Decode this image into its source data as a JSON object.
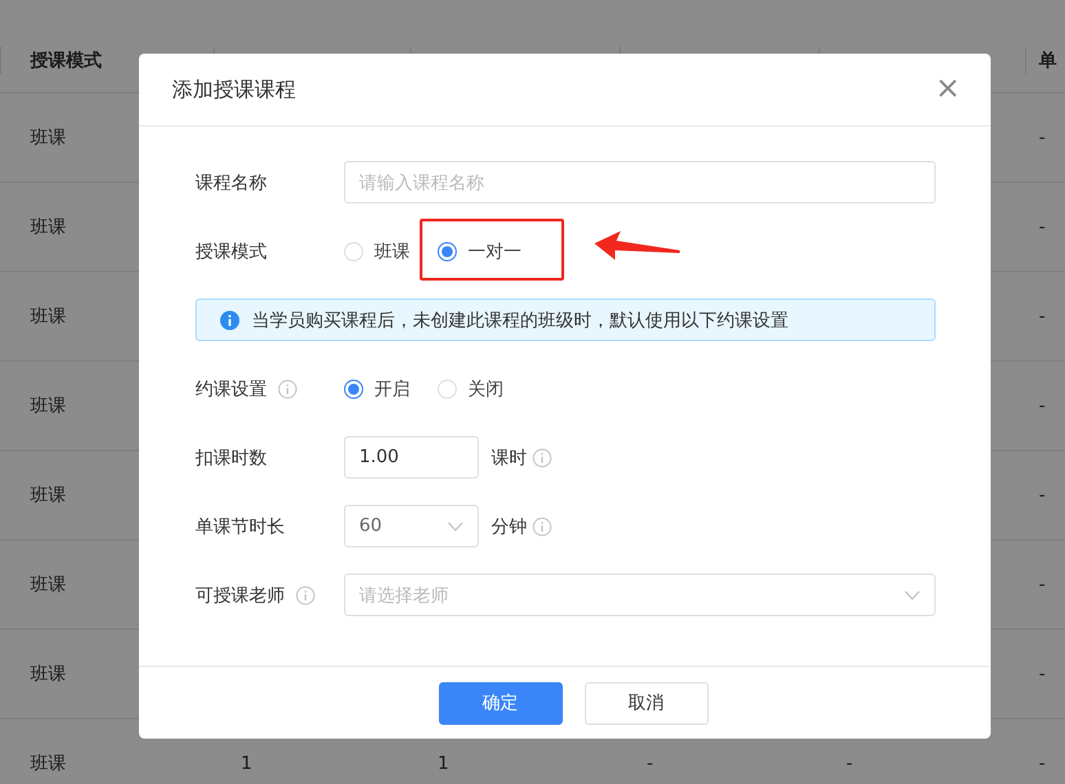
{
  "table": {
    "columns": [
      "授课模式",
      null,
      null,
      null,
      null,
      "单"
    ],
    "rows": [
      {
        "cells": [
          "班课",
          null,
          null,
          null,
          null,
          "-"
        ]
      },
      {
        "cells": [
          "班课",
          null,
          null,
          null,
          null,
          "-"
        ]
      },
      {
        "cells": [
          "班课",
          null,
          null,
          null,
          null,
          "-"
        ]
      },
      {
        "cells": [
          "班课",
          null,
          null,
          null,
          null,
          "-"
        ]
      },
      {
        "cells": [
          "班课",
          null,
          null,
          null,
          null,
          "-"
        ]
      },
      {
        "cells": [
          "班课",
          null,
          null,
          null,
          null,
          "-"
        ]
      },
      {
        "cells": [
          "班课",
          null,
          null,
          null,
          null,
          "-"
        ]
      },
      {
        "cells": [
          "班课",
          "1",
          "1",
          "-",
          "-",
          "-"
        ]
      }
    ]
  },
  "dialog": {
    "title": "添加授课课程",
    "close": "×",
    "fields": [
      {
        "kind": "text",
        "label": "课程名称",
        "placeholder": "请输入课程名称"
      },
      {
        "kind": "radio",
        "label": "授课模式",
        "highlighted": true,
        "options": [
          {
            "label": "班课",
            "selected": false
          },
          {
            "label": "一对一",
            "selected": true
          }
        ]
      },
      {
        "kind": "alert",
        "text": "当学员购买课程后，未创建此课程的班级时，默认使用以下约课设置"
      },
      {
        "kind": "radio",
        "label": "约课设置",
        "label_info": true,
        "options": [
          {
            "label": "开启",
            "selected": true
          },
          {
            "label": "关闭",
            "selected": false
          }
        ]
      },
      {
        "kind": "number",
        "label": "扣课时数",
        "value": "1.00",
        "unit": "课时",
        "unit_info": true
      },
      {
        "kind": "select",
        "label": "单课节时长",
        "value": "60",
        "unit": "分钟",
        "unit_info": true
      },
      {
        "kind": "select",
        "label": "可授课老师",
        "label_info": true,
        "placeholder": "请选择老师",
        "wide": true
      }
    ],
    "buttons": [
      {
        "label": "确定",
        "primary": true
      },
      {
        "label": "取消",
        "primary": false
      }
    ]
  }
}
